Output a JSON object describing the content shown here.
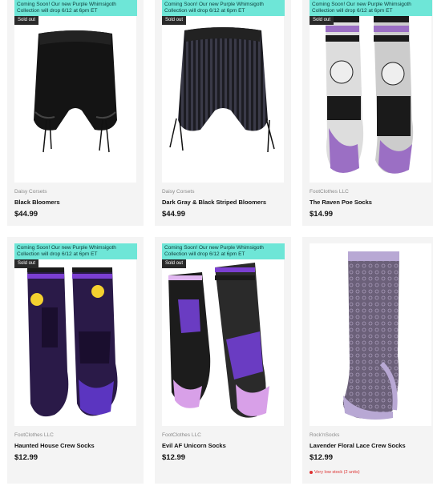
{
  "banner_text": "Coming Soon! Our new Purple Whimsigoth Collection will drop 6/12 at 6pm ET",
  "sold_out_label": "Sold out",
  "products": [
    {
      "vendor": "Daisy Corsets",
      "title": "Black Bloomers",
      "price": "$44.99",
      "image": "black-bloomers"
    },
    {
      "vendor": "Daisy Corsets",
      "title": "Dark Gray & Black Striped Bloomers",
      "price": "$44.99",
      "image": "striped-bloomers"
    },
    {
      "vendor": "FootClothes LLC",
      "title": "The Raven Poe Socks",
      "price": "$14.99",
      "image": "raven-poe-socks"
    },
    {
      "vendor": "FootClothes LLC",
      "title": "Haunted House Crew Socks",
      "price": "$12.99",
      "image": "haunted-house-socks"
    },
    {
      "vendor": "FootClothes LLC",
      "title": "Evil AF Unicorn Socks",
      "price": "$12.99",
      "image": "unicorn-socks"
    },
    {
      "vendor": "Rock'nSocks",
      "title": "Lavender Floral Lace Crew Socks",
      "price": "$12.99",
      "image": "lavender-lace-socks",
      "stock_note": "Very low stock (2 units)"
    }
  ],
  "colors": {
    "banner": "#6ee6d7",
    "sold_out": "#2a2a2a",
    "low_stock": "#dd3333",
    "card_bg": "#f4f4f4"
  }
}
